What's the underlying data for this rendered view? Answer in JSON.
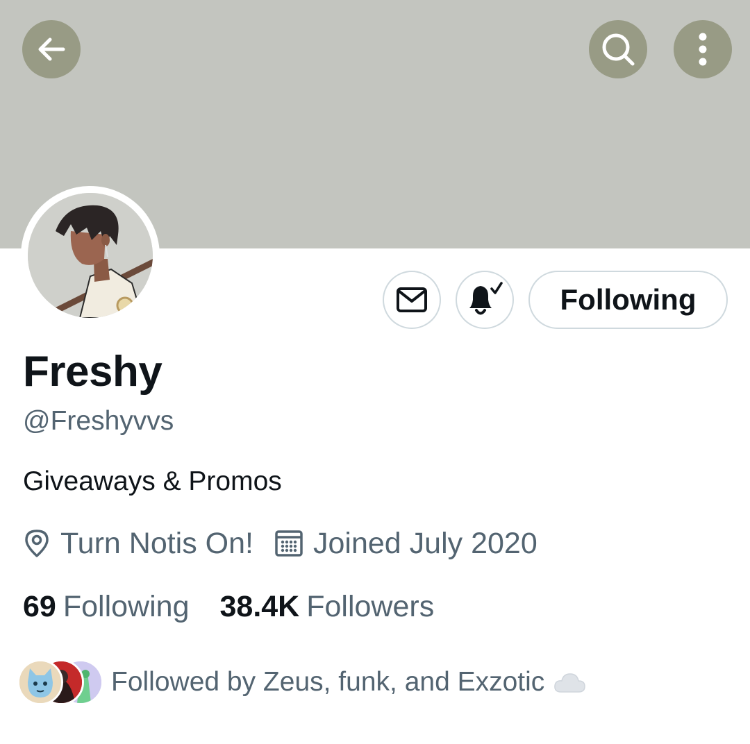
{
  "header": {
    "back_icon": "arrow-left-icon",
    "search_icon": "search-icon",
    "more_icon": "more-vertical-icon"
  },
  "profile": {
    "name": "Freshy",
    "handle": "@Freshyvvs",
    "bio": "Giveaways & Promos",
    "location": "Turn Notis On!",
    "joined": "Joined July 2020",
    "following_count": "69",
    "following_label": "Following",
    "followers_count": "38.4K",
    "followers_label": "Followers"
  },
  "actions": {
    "message_icon": "envelope-icon",
    "notify_icon": "bell-check-icon",
    "following_button": "Following"
  },
  "followed_by": {
    "text": "Followed by Zeus, funk, and Exzotic",
    "emoji": "cloud-icon"
  },
  "colors": {
    "banner": "#c3c5bf",
    "header_button": "#989b85",
    "primary_text": "#0f1419",
    "secondary_text": "#536471",
    "border": "#cfd9de"
  }
}
